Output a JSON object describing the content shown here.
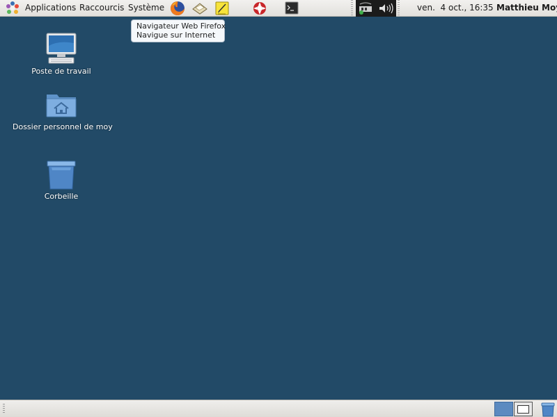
{
  "top_panel": {
    "menus": {
      "applications": "Applications",
      "places": "Raccourcis",
      "system": "Système"
    },
    "launchers": [
      "firefox-icon",
      "mail-icon",
      "notes-icon",
      "help-icon",
      "terminal-icon"
    ],
    "clock": "ven.  4 oct., 16:35",
    "user": "Matthieu Moy"
  },
  "tooltip": {
    "title": "Navigateur Web Firefox",
    "subtitle": "Navigue sur Internet"
  },
  "desktop": {
    "background": "#224a67",
    "icons": [
      {
        "label": "Poste de travail",
        "icon": "computer-icon"
      },
      {
        "label": "Dossier personnel de moy",
        "icon": "home-folder-icon"
      },
      {
        "label": "Corbeille",
        "icon": "trash-icon"
      }
    ]
  },
  "bottom_panel": {
    "workspaces": [
      "workspace-1",
      "workspace-2"
    ],
    "trash_applet": "trash-icon"
  }
}
